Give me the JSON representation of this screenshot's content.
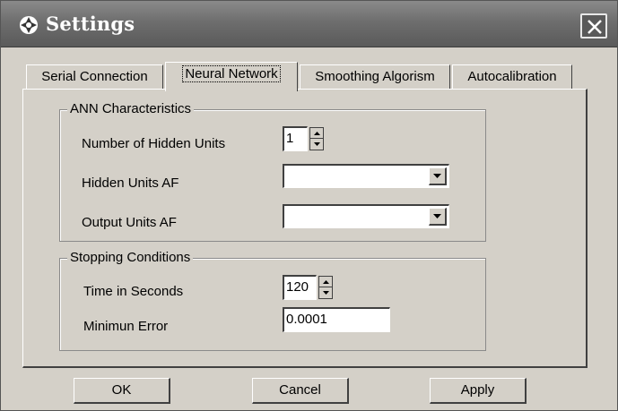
{
  "window": {
    "title": "Settings"
  },
  "icons": {
    "app": "gear-icon",
    "close": "close-icon"
  },
  "tabs": [
    {
      "label": "Serial Connection",
      "active": false
    },
    {
      "label": "Neural Network",
      "active": true
    },
    {
      "label": "Smoothing Algorism",
      "active": false
    },
    {
      "label": "Autocalibration",
      "active": false
    }
  ],
  "ann": {
    "group_label": "ANN Characteristics",
    "hidden_units_label": "Number of Hidden Units",
    "hidden_units_value": "1",
    "hidden_af_label": "Hidden Units AF",
    "hidden_af_value": "",
    "output_af_label": "Output Units AF",
    "output_af_value": ""
  },
  "stopping": {
    "group_label": "Stopping Conditions",
    "time_label": "Time in Seconds",
    "time_value": "120",
    "error_label": "Minimun Error",
    "error_value": "0.0001"
  },
  "buttons": {
    "ok": "OK",
    "cancel": "Cancel",
    "apply": "Apply"
  }
}
